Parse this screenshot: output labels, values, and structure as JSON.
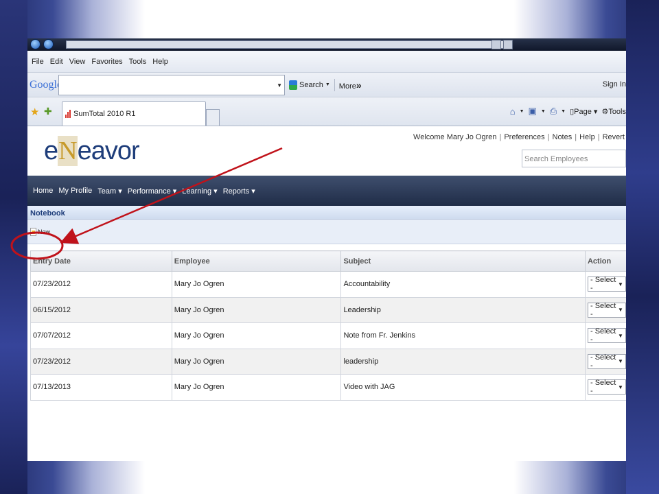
{
  "menubar": [
    "File",
    "Edit",
    "View",
    "Favorites",
    "Tools",
    "Help"
  ],
  "google": {
    "logo": "Google",
    "search_label": "Search",
    "more_label": "More",
    "more_glyph": "»",
    "sign_in": "Sign In"
  },
  "tab": {
    "title": "SumTotal 2010 R1"
  },
  "commandbar": {
    "page_label": "Page",
    "tools_label": "Tools"
  },
  "header": {
    "logo_prefix": "e",
    "logo_mark": "N",
    "logo_suffix": "eavor",
    "welcome": "Welcome Mary Jo Ogren",
    "links": [
      "Preferences",
      "Notes",
      "Help",
      "Revert"
    ],
    "search_placeholder": "Search Employees"
  },
  "nav": [
    "Home",
    "My Profile",
    "Team ▾",
    "Performance ▾",
    "Learning ▾",
    "Reports ▾"
  ],
  "page_title": "Notebook",
  "toolbar": {
    "new_label": "New"
  },
  "table": {
    "columns": [
      "Entry Date",
      "Employee",
      "Subject",
      "Action"
    ],
    "rows": [
      {
        "date": "07/23/2012",
        "employee": "Mary Jo Ogren",
        "subject": "Accountability",
        "action": "- Select -"
      },
      {
        "date": "06/15/2012",
        "employee": "Mary Jo Ogren",
        "subject": "Leadership",
        "action": "- Select -"
      },
      {
        "date": "07/07/2012",
        "employee": "Mary Jo Ogren",
        "subject": "Note from Fr. Jenkins",
        "action": "- Select -"
      },
      {
        "date": "07/23/2012",
        "employee": "Mary Jo Ogren",
        "subject": "leadership",
        "action": "- Select -"
      },
      {
        "date": "07/13/2013",
        "employee": "Mary Jo Ogren",
        "subject": "Video with JAG",
        "action": "- Select -"
      }
    ]
  },
  "annotation": {
    "color": "#c0121a"
  }
}
